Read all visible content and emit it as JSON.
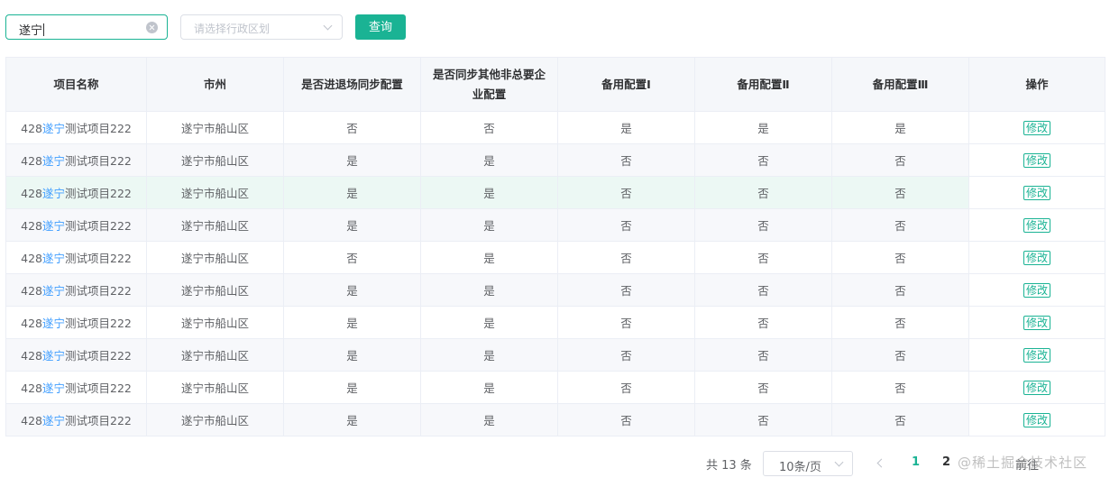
{
  "filters": {
    "search_value": "遂宁",
    "region_placeholder": "请选择行政区划",
    "query_label": "查询"
  },
  "table": {
    "columns": [
      "项目名称",
      "市州",
      "是否进退场同步配置",
      "是否同步其他非总要企业配置",
      "备用配置Ⅰ",
      "备用配置Ⅱ",
      "备用配置Ⅲ",
      "操作"
    ],
    "rows": [
      {
        "name_prefix": "428",
        "name_highlight": "遂宁",
        "name_suffix": "测试项目222",
        "city": "遂宁市船山区",
        "sync_entry": "否",
        "sync_other": "否",
        "backup1": "是",
        "backup2": "是",
        "backup3": "是",
        "action": "修改"
      },
      {
        "name_prefix": "428",
        "name_highlight": "遂宁",
        "name_suffix": "测试项目222",
        "city": "遂宁市船山区",
        "sync_entry": "是",
        "sync_other": "是",
        "backup1": "否",
        "backup2": "否",
        "backup3": "否",
        "action": "修改"
      },
      {
        "name_prefix": "428",
        "name_highlight": "遂宁",
        "name_suffix": "测试项目222",
        "city": "遂宁市船山区",
        "sync_entry": "是",
        "sync_other": "是",
        "backup1": "否",
        "backup2": "否",
        "backup3": "否",
        "action": "修改"
      },
      {
        "name_prefix": "428",
        "name_highlight": "遂宁",
        "name_suffix": "测试项目222",
        "city": "遂宁市船山区",
        "sync_entry": "是",
        "sync_other": "是",
        "backup1": "否",
        "backup2": "否",
        "backup3": "否",
        "action": "修改"
      },
      {
        "name_prefix": "428",
        "name_highlight": "遂宁",
        "name_suffix": "测试项目222",
        "city": "遂宁市船山区",
        "sync_entry": "否",
        "sync_other": "是",
        "backup1": "否",
        "backup2": "否",
        "backup3": "否",
        "action": "修改"
      },
      {
        "name_prefix": "428",
        "name_highlight": "遂宁",
        "name_suffix": "测试项目222",
        "city": "遂宁市船山区",
        "sync_entry": "是",
        "sync_other": "是",
        "backup1": "否",
        "backup2": "否",
        "backup3": "否",
        "action": "修改"
      },
      {
        "name_prefix": "428",
        "name_highlight": "遂宁",
        "name_suffix": "测试项目222",
        "city": "遂宁市船山区",
        "sync_entry": "是",
        "sync_other": "是",
        "backup1": "否",
        "backup2": "否",
        "backup3": "否",
        "action": "修改"
      },
      {
        "name_prefix": "428",
        "name_highlight": "遂宁",
        "name_suffix": "测试项目222",
        "city": "遂宁市船山区",
        "sync_entry": "是",
        "sync_other": "是",
        "backup1": "否",
        "backup2": "否",
        "backup3": "否",
        "action": "修改"
      },
      {
        "name_prefix": "428",
        "name_highlight": "遂宁",
        "name_suffix": "测试项目222",
        "city": "遂宁市船山区",
        "sync_entry": "是",
        "sync_other": "是",
        "backup1": "否",
        "backup2": "否",
        "backup3": "否",
        "action": "修改"
      },
      {
        "name_prefix": "428",
        "name_highlight": "遂宁",
        "name_suffix": "测试项目222",
        "city": "遂宁市船山区",
        "sync_entry": "是",
        "sync_other": "是",
        "backup1": "否",
        "backup2": "否",
        "backup3": "否",
        "action": "修改"
      }
    ]
  },
  "pagination": {
    "total_label": "共 13 条",
    "page_size": "10条/页",
    "pages": [
      "1",
      "2"
    ],
    "current_page": "1",
    "goto_label": "前往"
  },
  "watermark": "@稀土掘金技术社区",
  "colors": {
    "accent": "#1ab394",
    "highlight": "#409eff",
    "header_bg": "#f5f7fa",
    "hover_row": "#ecf8f4"
  }
}
